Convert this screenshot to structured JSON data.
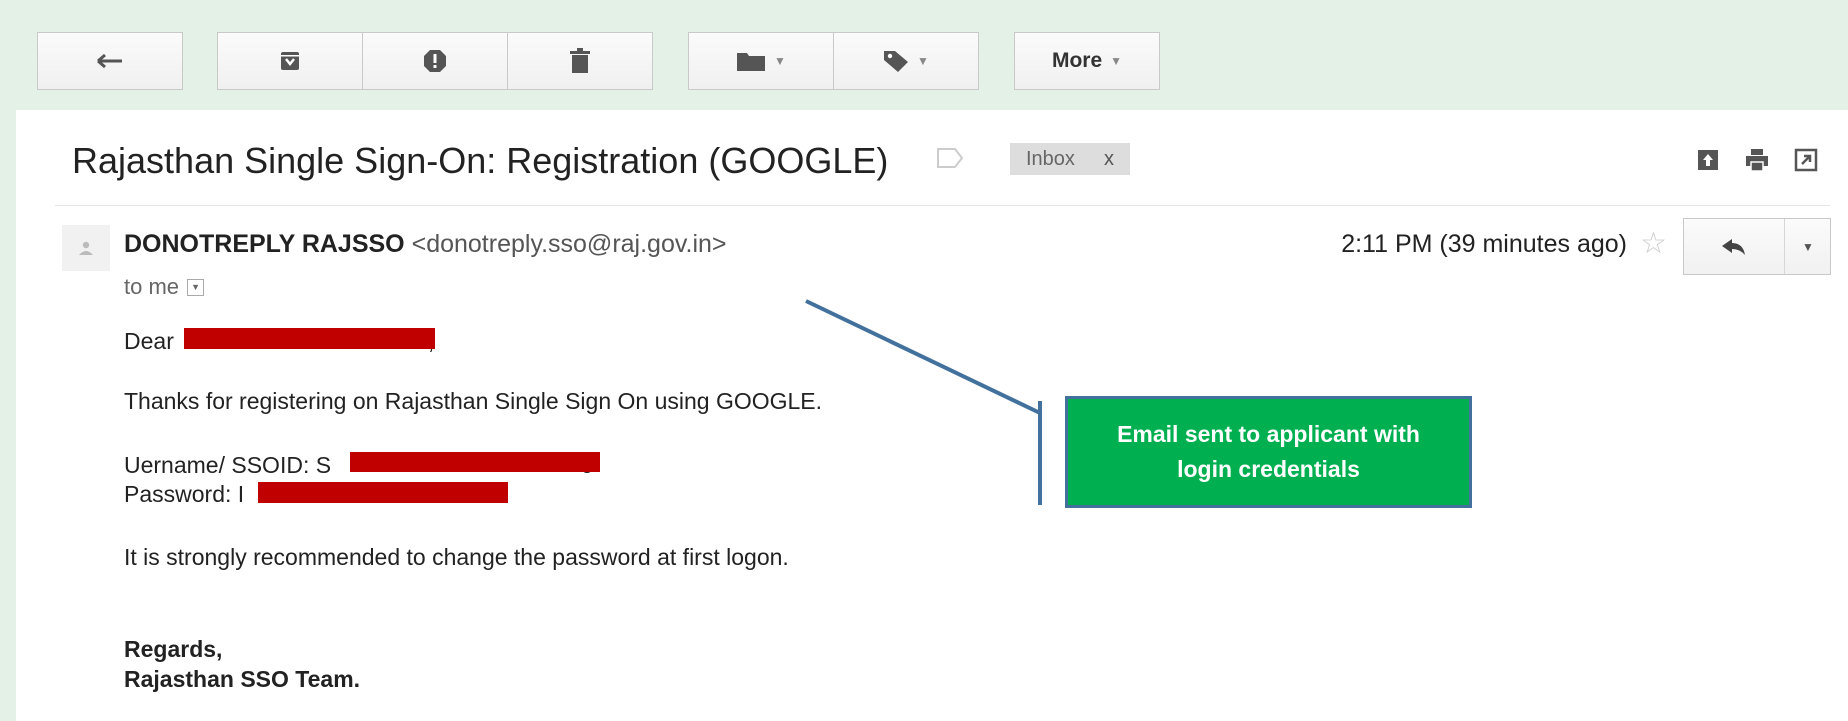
{
  "toolbar": {
    "back_icon": "reply-arrow-icon",
    "archive_icon": "archive-icon",
    "spam_icon": "report-spam-icon",
    "delete_icon": "trash-icon",
    "move_icon": "folder-icon",
    "labels_icon": "tag-icon",
    "more_label": "More"
  },
  "email": {
    "subject": "Rajasthan Single Sign-On: Registration (GOOGLE)",
    "label_tag": "Inbox",
    "label_remove": "x",
    "sender_name": "DONOTREPLY RAJSSO",
    "sender_email": "<donotreply.sso@raj.gov.in>",
    "recipient": "to me",
    "timestamp": "2:11 PM (39 minutes ago)",
    "body": {
      "greeting_prefix": "Dear",
      "greeting_suffix": ",",
      "thanks_line": "Thanks for registering on Rajasthan Single Sign On using GOOGLE.",
      "username_label": "Uername/ SSOID: S",
      "username_tail": "9",
      "password_label": "Password: I",
      "recommendation": "It is strongly recommended to change the password at first logon.",
      "regards": "Regards,",
      "team": "Rajasthan SSO Team."
    }
  },
  "annotation": {
    "text": "Email sent to applicant with login credentials",
    "fill_color": "#00b050",
    "border_color": "#41719c"
  },
  "colors": {
    "redaction": "#c00000",
    "window_bg": "#e3f1e6"
  }
}
